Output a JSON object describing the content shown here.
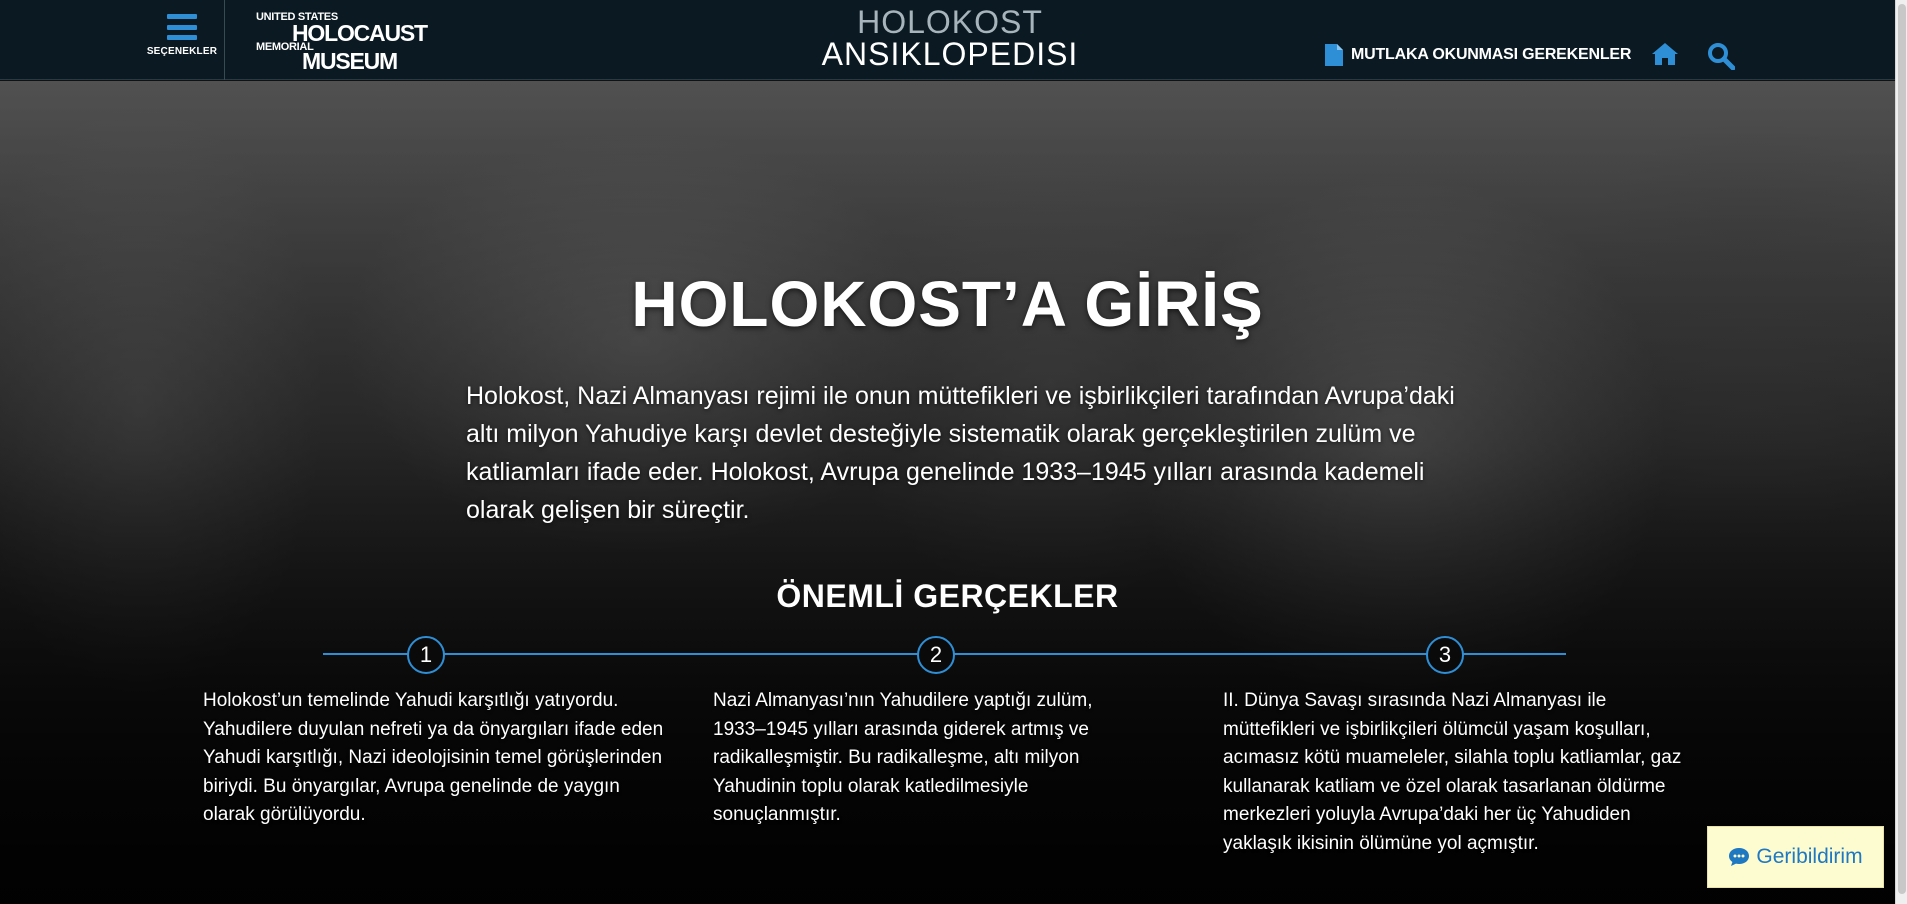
{
  "header": {
    "menu_label": "SEÇENEKLER",
    "logo": {
      "line1": "UNITED STATES",
      "line2": "HOLOCAUST",
      "line3": "MEMORIAL",
      "line4": "MUSEUM"
    },
    "site_title_top": "HOLOKOST",
    "site_title_bottom": "ANSIKLOPEDISI",
    "must_read_label": "MUTLAKA OKUNMASI GEREKENLER"
  },
  "hero": {
    "title": "HOLOKOST’A GİRİŞ",
    "intro": "Holokost, Nazi Almanyası rejimi ile onun müttefikleri ve işbirlikçileri tarafından Avrupa’daki altı milyon Yahudiye karşı devlet desteğiyle sistematik olarak gerçekleştirilen zulüm ve katliamları ifade eder. Holokost, Avrupa genelinde 1933–1945 yılları arasında kademeli olarak gelişen bir süreçtir."
  },
  "facts": {
    "title": "ÖNEMLİ GERÇEKLER",
    "items": [
      {
        "number": "1",
        "text": "Holokost’un temelinde Yahudi karşıtlığı yatıyordu. Yahudilere duyulan nefreti ya da önyargıları ifade eden Yahudi karşıtlığı, Nazi ideolojisinin temel görüşlerinden biriydi. Bu önyargılar, Avrupa genelinde de yaygın olarak görülüyordu."
      },
      {
        "number": "2",
        "text": "Nazi Almanyası’nın Yahudilere yaptığı zulüm, 1933–1945 yılları arasında giderek artmış ve radikalleşmiştir. Bu radikalleşme, altı milyon Yahudinin toplu olarak katledilmesiyle sonuçlanmıştır."
      },
      {
        "number": "3",
        "text": "II. Dünya Savaşı sırasında Nazi Almanyası ile müttefikleri ve işbirlikçileri ölümcül yaşam koşulları, acımasız kötü muameleler, silahla toplu katliamlar, gaz kullanarak katliam ve özel olarak tasarlanan öldürme merkezleri yoluyla Avrupa’daki her üç Yahudiden yaklaşık ikisinin ölümüne yol açmıştır."
      }
    ]
  },
  "feedback_label": "Geribildirim",
  "colors": {
    "header_bg": "#0b1a22",
    "accent": "#2f8fd6",
    "feedback_bg": "#fdfbd0",
    "feedback_text": "#1e78c2"
  },
  "icons": {
    "menu": "hamburger-icon",
    "must_read": "document-icon",
    "home": "home-icon",
    "search": "search-icon",
    "feedback": "comment-icon"
  }
}
